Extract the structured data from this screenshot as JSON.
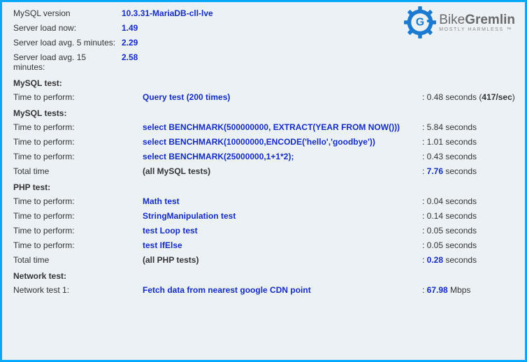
{
  "brand": {
    "name_left": "Bike",
    "name_right": "Gremlin",
    "tagline": "MOSTLY HARMLESS ™"
  },
  "top_stats": [
    {
      "label": "MySQL version",
      "value": "10.3.31-MariaDB-cll-lve"
    },
    {
      "label": "Server load now:",
      "value": "1.49"
    },
    {
      "label": "Server load avg. 5 minutes:",
      "value": "2.29"
    },
    {
      "label": "Server load avg. 15 minutes:",
      "value": "2.58"
    }
  ],
  "sections": {
    "mysql_test": {
      "heading": "MySQL test:"
    },
    "mysql_tests": {
      "heading": "MySQL tests:"
    },
    "php_test": {
      "heading": "PHP test:"
    },
    "network_test": {
      "heading": "Network test:"
    }
  },
  "mysql_single": {
    "label": "Time to perform:",
    "desc": "Query test (200 times)",
    "result_prefix": ": 0.48 seconds (",
    "result_bold": "417/sec",
    "result_suffix": ")"
  },
  "mysql_rows": [
    {
      "label": "Time to perform:",
      "desc": "select BENCHMARK(500000000, EXTRACT(YEAR FROM NOW()))",
      "result": ": 5.84 seconds"
    },
    {
      "label": "Time to perform:",
      "desc": "select BENCHMARK(10000000,ENCODE('hello','goodbye'))",
      "result": ": 1.01 seconds"
    },
    {
      "label": "Time to perform:",
      "desc": "select BENCHMARK(25000000,1+1*2);",
      "result": ": 0.43 seconds"
    }
  ],
  "mysql_total": {
    "label": "Total time",
    "desc": "(all MySQL tests)",
    "result_prefix": ": ",
    "result_bold": "7.76",
    "result_suffix": " seconds"
  },
  "php_rows": [
    {
      "label": "Time to perform:",
      "desc": "Math test",
      "result": ": 0.04 seconds"
    },
    {
      "label": "Time to perform:",
      "desc": "StringManipulation test",
      "result": ": 0.14 seconds"
    },
    {
      "label": "Time to perform:",
      "desc": "test Loop test",
      "result": ": 0.05 seconds"
    },
    {
      "label": "Time to perform:",
      "desc": "test IfElse",
      "result": ": 0.05 seconds"
    }
  ],
  "php_total": {
    "label": "Total time",
    "desc": "(all PHP tests)",
    "result_prefix": ": ",
    "result_bold": "0.28",
    "result_suffix": " seconds"
  },
  "network_row": {
    "label": "Network test 1:",
    "desc": "Fetch data from nearest google CDN point",
    "result_prefix": ": ",
    "result_bold": "67.98",
    "result_suffix": " Mbps"
  }
}
